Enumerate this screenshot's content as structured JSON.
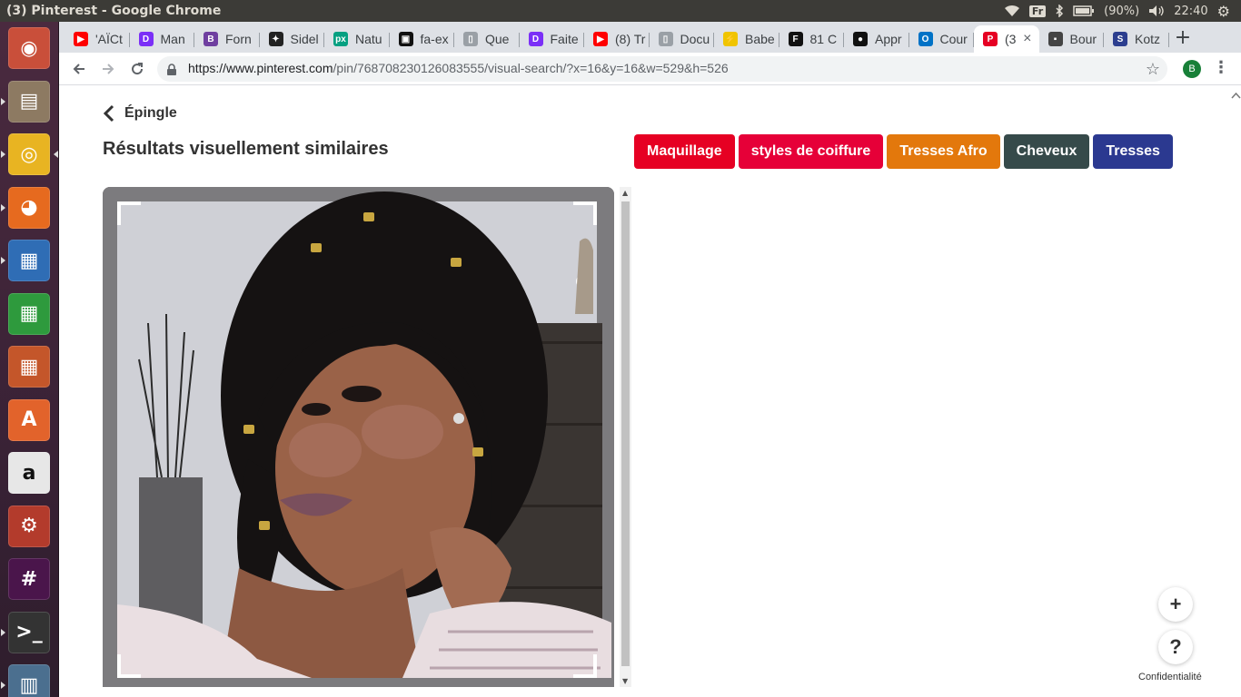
{
  "os": {
    "window_title": "(3) Pinterest - Google Chrome",
    "keyboard_layout": "Fr",
    "battery": "(90%)",
    "clock": "22:40"
  },
  "launcher": [
    {
      "name": "ubuntu-dash",
      "color": "#c94f3a",
      "glyph": "◉"
    },
    {
      "name": "files",
      "color": "#8d7a62",
      "glyph": "▤"
    },
    {
      "name": "chrome",
      "color": "#e8b422",
      "glyph": "◎"
    },
    {
      "name": "firefox",
      "color": "#e66a1f",
      "glyph": "◕"
    },
    {
      "name": "libreoffice-writer",
      "color": "#2f6db5",
      "glyph": "▦"
    },
    {
      "name": "libreoffice-calc",
      "color": "#2e9a3d",
      "glyph": "▦"
    },
    {
      "name": "libreoffice-impress",
      "color": "#c4562a",
      "glyph": "▦"
    },
    {
      "name": "software-center",
      "color": "#e2632b",
      "glyph": "A"
    },
    {
      "name": "amazon",
      "color": "#e7e7e7",
      "glyph": "a"
    },
    {
      "name": "system-settings",
      "color": "#b33b2c",
      "glyph": "⚙"
    },
    {
      "name": "slack",
      "color": "#4a154b",
      "glyph": "#"
    },
    {
      "name": "terminal",
      "color": "#333333",
      "glyph": ">_"
    },
    {
      "name": "workspaces",
      "color": "#4b6f8f",
      "glyph": "▥"
    }
  ],
  "tabs": [
    {
      "title": "'AÏCt",
      "fav_color": "#ff0000",
      "fav": "▶"
    },
    {
      "title": "Man",
      "fav_color": "#7b2ff7",
      "fav": "D"
    },
    {
      "title": "Forn",
      "fav_color": "#6f3fa0",
      "fav": "B"
    },
    {
      "title": "Sidel",
      "fav_color": "#222222",
      "fav": "✦"
    },
    {
      "title": "Natu",
      "fav_color": "#05a081",
      "fav": "px"
    },
    {
      "title": "fa-ex",
      "fav_color": "#111111",
      "fav": "▣"
    },
    {
      "title": "Que",
      "fav_color": "#9aa0a6",
      "fav": "▯"
    },
    {
      "title": "Faite",
      "fav_color": "#7b2ff7",
      "fav": "D"
    },
    {
      "title": "(8) Tr",
      "fav_color": "#ff0000",
      "fav": "▶"
    },
    {
      "title": "Docu",
      "fav_color": "#9aa0a6",
      "fav": "▯"
    },
    {
      "title": "Babe",
      "fav_color": "#f0c400",
      "fav": "⚡"
    },
    {
      "title": "81 C",
      "fav_color": "#111111",
      "fav": "F"
    },
    {
      "title": "Appr",
      "fav_color": "#111111",
      "fav": "●"
    },
    {
      "title": "Cour",
      "fav_color": "#0072c6",
      "fav": "O"
    },
    {
      "title": "(3",
      "fav_color": "#e60023",
      "fav": "P",
      "active": true
    },
    {
      "title": "Bour",
      "fav_color": "#444444",
      "fav": "▪"
    },
    {
      "title": "Kotz",
      "fav_color": "#2c3e8f",
      "fav": "S"
    }
  ],
  "address": {
    "url_host": "https://www.pinterest.com",
    "url_path": "/pin/768708230126083555/visual-search/?x=16&y=16&w=529&h=526",
    "profile_initial": "B"
  },
  "page": {
    "back_label": "Épingle",
    "title": "Résultats visuellement similaires",
    "chips": [
      {
        "label": "Maquillage",
        "color": "#e60023"
      },
      {
        "label": "styles de coiffure",
        "color": "#e60038"
      },
      {
        "label": "Tresses Afro",
        "color": "#e3780c"
      },
      {
        "label": "Cheveux",
        "color": "#364a4a"
      },
      {
        "label": "Tresses",
        "color": "#2b3990"
      }
    ],
    "fab_add": "+",
    "fab_help": "?",
    "privacy": "Confidentialité"
  }
}
